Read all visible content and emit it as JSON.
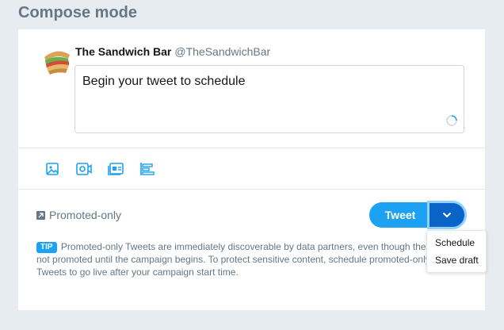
{
  "page": {
    "title": "Compose mode"
  },
  "composer": {
    "author_name": "The Sandwich Bar",
    "author_handle": "@TheSandwichBar",
    "tweet_text": "Begin your tweet to schedule",
    "toolbar": [
      {
        "icon": "image-icon"
      },
      {
        "icon": "video-icon"
      },
      {
        "icon": "card-icon"
      },
      {
        "icon": "poll-icon"
      }
    ]
  },
  "promoted": {
    "label": "Promoted-only"
  },
  "actions": {
    "tweet_label": "Tweet",
    "dropdown_icon": "chevron-down-icon",
    "menu_items": [
      "Schedule",
      "Save draft"
    ]
  },
  "tip": {
    "badge": "TIP",
    "text": "Promoted-only Tweets are immediately discoverable by data partners, even though they're not promoted until the campaign begins. To protect sensitive content, schedule promoted-only Tweets to go live after your campaign start time."
  },
  "colors": {
    "accent": "#1da1f2",
    "dropdown": "#0a64c8",
    "background": "#e6ecf0"
  }
}
